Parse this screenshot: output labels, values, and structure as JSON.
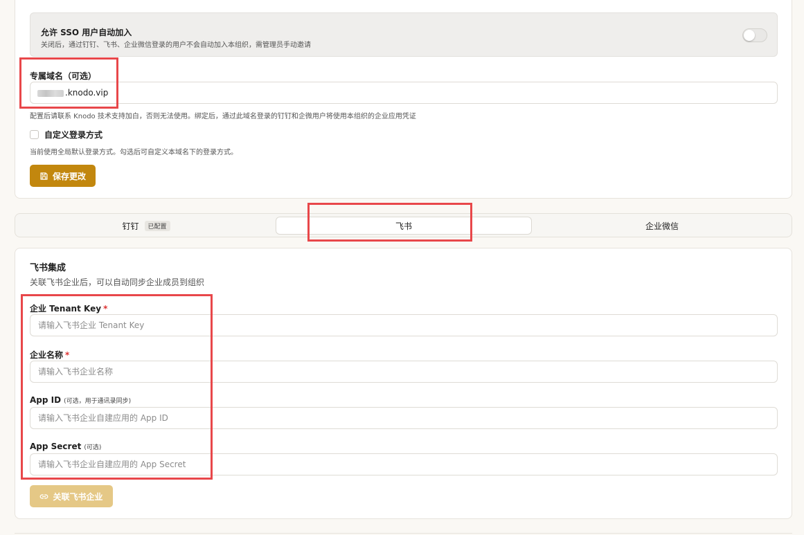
{
  "sso": {
    "title": "允许 SSO 用户自动加入",
    "description": "关闭后，通过钉钉、飞书、企业微信登录的用户不会自动加入本组织，需管理员手动邀请",
    "enabled": false
  },
  "domain": {
    "label": "专属域名（可选）",
    "value": ".knodo.vip",
    "hint": "配置后请联系 Knodo 技术支持加白，否则无法使用。绑定后，通过此域名登录的钉钉和企微用户将使用本组织的企业应用凭证"
  },
  "custom_login": {
    "label": "自定义登录方式",
    "checked": false,
    "hint": "当前使用全局默认登录方式。勾选后可自定义本域名下的登录方式。"
  },
  "save_button": {
    "label": "保存更改",
    "icon": "save-icon"
  },
  "tabs": [
    {
      "label": "钉钉",
      "badge": "已配置"
    },
    {
      "label": "飞书",
      "active": true
    },
    {
      "label": "企业微信"
    }
  ],
  "feishu": {
    "title": "飞书集成",
    "description": "关联飞书企业后，可以自动同步企业成员到组织",
    "fields": {
      "tenant_key": {
        "label": "企业 Tenant Key",
        "required": "*",
        "placeholder": "请输入飞书企业 Tenant Key"
      },
      "company_name": {
        "label": "企业名称",
        "required": "*",
        "placeholder": "请输入飞书企业名称"
      },
      "app_id": {
        "label": "App ID",
        "note": "(可选，用于通讯录同步)",
        "placeholder": "请输入飞书企业自建应用的 App ID"
      },
      "app_secret": {
        "label": "App Secret",
        "note": "(可选)",
        "placeholder": "请输入飞书企业自建应用的 App Secret"
      }
    },
    "link_button": {
      "label": "关联飞书企业",
      "icon": "link-icon"
    }
  },
  "colors": {
    "primary": "#c2870e",
    "primary_disabled": "#e5c886",
    "annotation": "#e8474a",
    "required": "#dd3333"
  }
}
